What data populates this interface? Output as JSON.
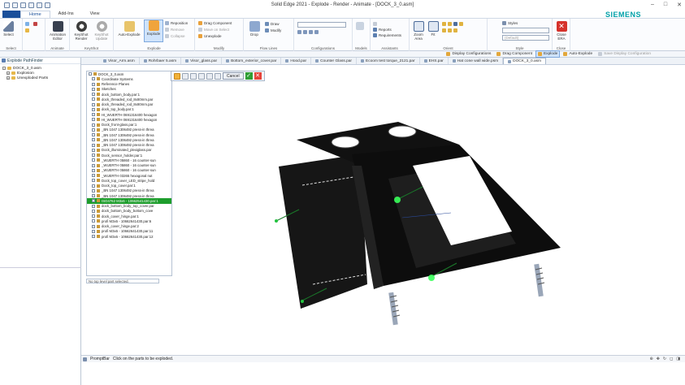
{
  "window": {
    "title": "Solid Edge 2021 - Explode - Render - Animate - [DOCK_3_0.asm]",
    "brand": "SIEMENS"
  },
  "ribbon_tabs": [
    "Home",
    "Add-Ins",
    "View"
  ],
  "ribbon": {
    "select": {
      "label": "Select",
      "group": "Select"
    },
    "animate": {
      "label": "Animation Editor",
      "group": "Animate"
    },
    "keyshot": {
      "render": "KeyShot Render",
      "update": "KeyShot Update",
      "group": "KeyShot"
    },
    "explode": {
      "auto": "Auto-Explode",
      "explode": "Explode",
      "reposition": "Reposition",
      "remove": "Remove",
      "collapse": "Collapse",
      "group": "Explode"
    },
    "modify": {
      "drag": "Drag Component",
      "move_select": "Move on Select",
      "unexplode": "Unexplode",
      "group": "Modify"
    },
    "flowlines": {
      "drop": "Drop",
      "draw": "Draw",
      "modify": "Modify",
      "group": "Flow Lines"
    },
    "configurations": {
      "group": "Configurations",
      "combo": "Display"
    },
    "models": {
      "group": "Models"
    },
    "assistants": {
      "reports": "Reports",
      "requirements": "Requirements",
      "group": "Assistants"
    },
    "orient": {
      "zoom": "Zoom Area",
      "fit": "Fit",
      "group": "Orient"
    },
    "style": {
      "styles": "Styles",
      "default": "(Default)",
      "group": "Style"
    },
    "close": {
      "label": "Close ERA",
      "group": "Close"
    }
  },
  "command_bar": [
    "Display Configurations",
    "Drag Component",
    "Explode",
    "Auto-Explode",
    "Save Display Configuration"
  ],
  "left_panel": {
    "title": "Explode PathFinder",
    "tree": [
      "DOCK_3_0.asm",
      "Explosion",
      "Unexploded Parts"
    ]
  },
  "doc_tabs": [
    "Visor_Arm.asm",
    "Rohrbaer 5.asm",
    "Visor_glass.par",
    "Bottom_exterior_cover.par",
    "Hood.par",
    "Counter Glass.par",
    "Ecoom test torque_2121.par",
    "EHS.par",
    "Hat cone wall wide.psm",
    "DOCK_3_0.asm"
  ],
  "pathfinder": {
    "items": [
      "DOCK_3_0.asm",
      "Coordinate Systems",
      "Reference Planes",
      "Sketches",
      "dock_bottom_body.par:1",
      "dock_threaded_rod_8x80mm.par",
      "dock_threaded_rod_8x80mm.par",
      "dock_top_body.par:1",
      "HI_WUERTH 0691316400 hexagon",
      "HI_WUERTH 0691316400 hexagon",
      "Dock_front-glass.par:1",
      "_BN 1047 1306492 press-in threa",
      "_BN 1047 1306492 press-in threa",
      "_BN 1047 1306492 press-in threa",
      "_BN 1047 1306492 press-in threa",
      "Dock_illuminated_plexiglass.par",
      "Dock_sensor_holder.par:1",
      "_WUERTH 05860 - 16 counter-sun",
      "_WUERTH 05860 - 16 counter-sun",
      "_WUERTH 05860 - 16 counter-sun",
      "_WUERTH 03265 hexagonal nut",
      "Dock_top_cover_LED_stripe_hold",
      "Dock_top_cover.par:1",
      "_BN 1047 1306492 press-in threa",
      "_BN 1047 1306492 press-in threa",
      "ISO4762 M3x6 - 10662541430.par:1",
      "dock_bottom_body_top_cover.par",
      "dock_bottom_body_bottom_cove",
      "dock_cover_hinge.par:1",
      "profi M3x6 - 10662641430.par:6",
      "dock_cover_hinge.par:2",
      "profi M3x6 - 10662641430.par:11",
      "profi M3x6 - 10662641430.par:12"
    ],
    "selected_index": 25,
    "status": "No top level part selected."
  },
  "explode_toolbar": {
    "cancel": "Cancel"
  },
  "status": {
    "label": "PromptBar",
    "prompt": "Click on the parts to be exploded."
  },
  "colors": {
    "accent": "#1a4f9a",
    "selection": "#1d9d2c",
    "brand": "#00a0a8"
  }
}
